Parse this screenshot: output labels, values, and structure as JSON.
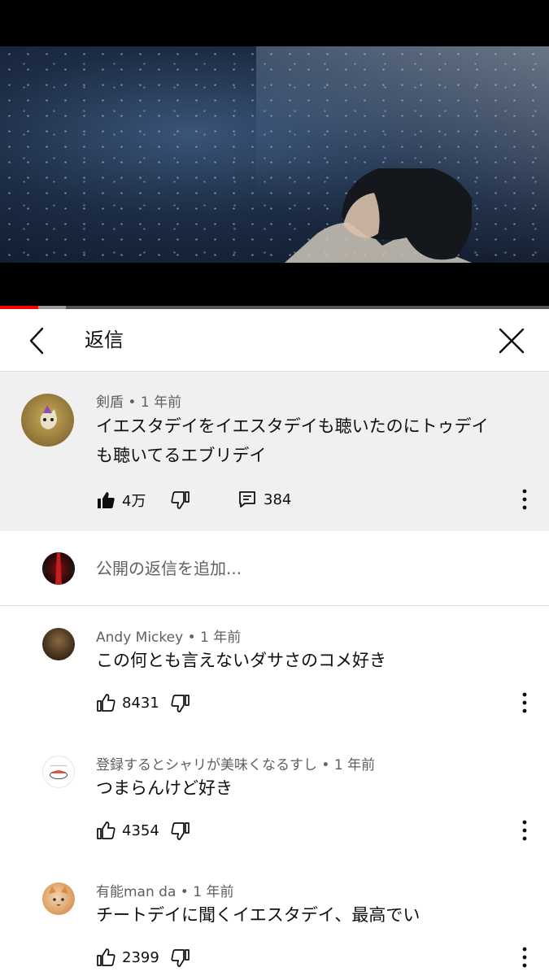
{
  "header": {
    "title": "返信"
  },
  "parent_comment": {
    "author": "剣盾",
    "time": "1 年前",
    "text_line1": "イエスタデイをイエスタデイも聴いたのにトゥデイ",
    "text_line2": "も聴いてるエブリデイ",
    "likes": "4万",
    "replies": "384"
  },
  "add_reply": {
    "placeholder": "公開の返信を追加..."
  },
  "replies": [
    {
      "author": "Andy Mickey",
      "time": "1 年前",
      "text": "この何とも言えないダサさのコメ好き",
      "likes": "8431"
    },
    {
      "author": "登録するとシャリが美味くなるすし",
      "time": "1 年前",
      "text": "つまらんけど好き",
      "likes": "4354"
    },
    {
      "author": "有能man da",
      "time": "1 年前",
      "text": "チートデイに聞くイエスタデイ、最高でい",
      "likes": "2399"
    }
  ],
  "separator": "•",
  "progress": {
    "played_fraction": 0.07,
    "buffered_fraction": 0.12
  },
  "colors": {
    "accent": "#ff0000",
    "parent_bg": "#f0f0f0",
    "secondary_text": "#606060"
  },
  "icons": {
    "back": "chevron-left-icon",
    "close": "close-icon",
    "like": "thumbs-up-icon",
    "dislike": "thumbs-down-icon",
    "reply": "comment-icon",
    "more": "more-vertical-icon"
  }
}
